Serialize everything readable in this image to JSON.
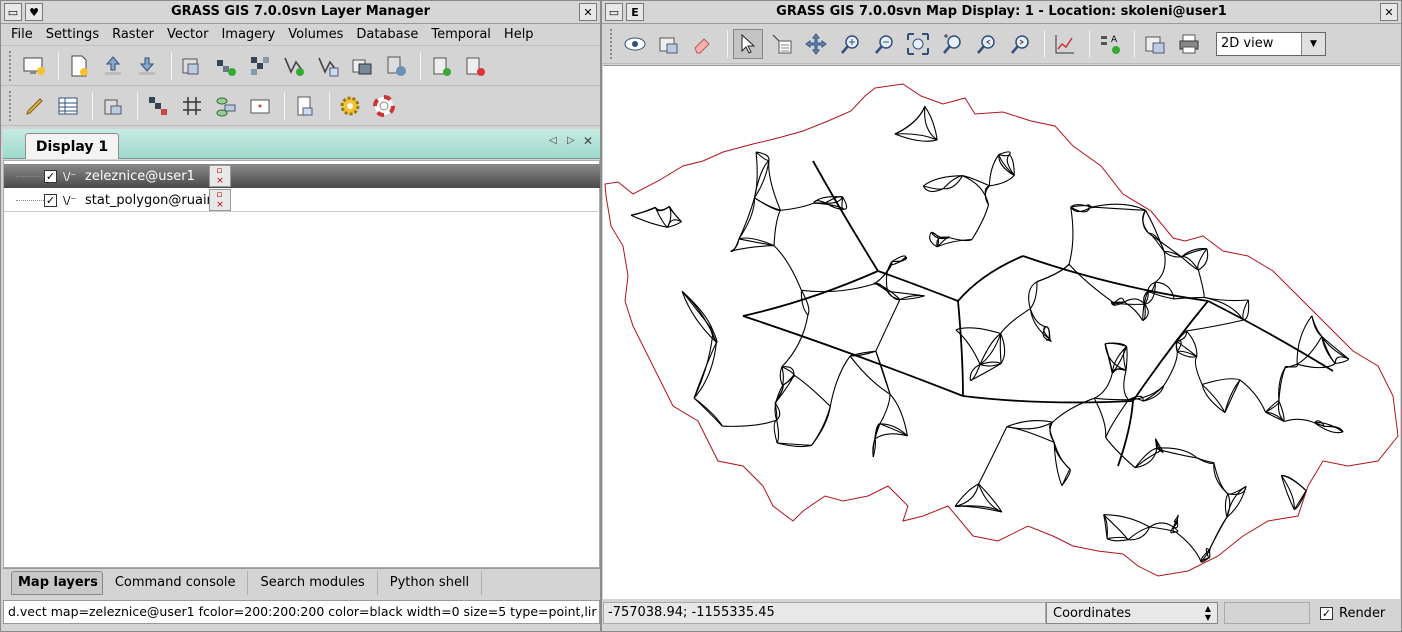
{
  "layer_manager": {
    "title": "GRASS GIS 7.0.0svn Layer Manager",
    "menus": [
      "File",
      "Settings",
      "Raster",
      "Vector",
      "Imagery",
      "Volumes",
      "Database",
      "Temporal",
      "Help"
    ],
    "display_tab": "Display 1",
    "layers": [
      {
        "name": "zeleznice@user1",
        "checked": true,
        "selected": true
      },
      {
        "name": "stat_polygon@ruain",
        "checked": true,
        "selected": false
      }
    ],
    "bottom_tabs": [
      "Map layers",
      "Command console",
      "Search modules",
      "Python shell"
    ],
    "status_command": "d.vect map=zeleznice@user1 fcolor=200:200:200 color=black width=0 size=5 type=point,lir"
  },
  "map_display": {
    "title": "GRASS GIS 7.0.0svn Map Display: 1  - Location: skoleni@user1",
    "view_mode": "2D view",
    "coordinates_readout": "-757038.94; -1155335.45",
    "coord_mode": "Coordinates",
    "render_label": "Render",
    "render_checked": true
  },
  "colors": {
    "rail_lines": "#000000",
    "border_line": "#b3121c",
    "tab_strip": "#9ed9cb"
  }
}
